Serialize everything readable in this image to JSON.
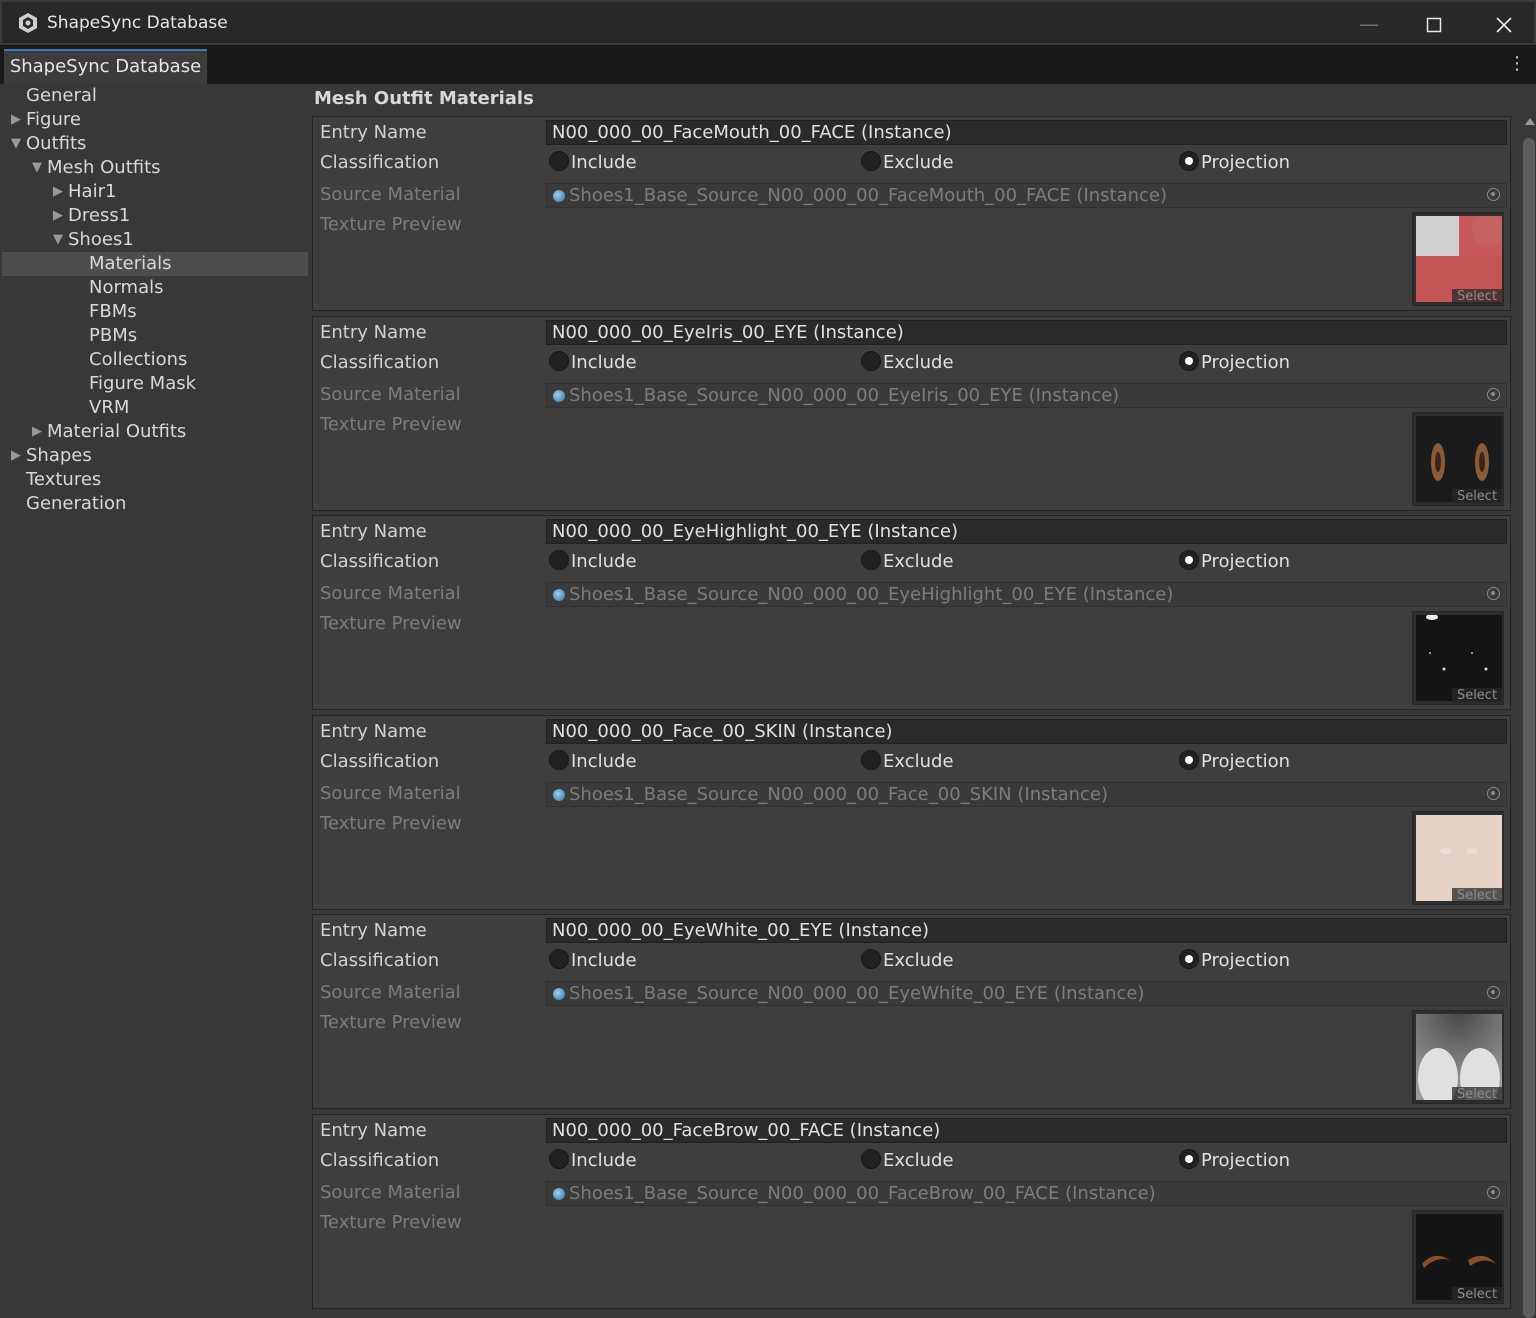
{
  "window": {
    "title": "ShapeSync Database",
    "controls": [
      "minimize-icon",
      "maximize-icon",
      "close-icon"
    ]
  },
  "tab": {
    "label": "ShapeSync Database",
    "menu_icon": "more-vertical-icon"
  },
  "sidebar": {
    "items": [
      {
        "label": "General"
      },
      {
        "label": "Figure",
        "arrow": "▶"
      },
      {
        "label": "Outfits",
        "arrow": "▼"
      },
      {
        "label": "Mesh Outfits",
        "arrow": "▼"
      },
      {
        "label": "Hair1",
        "arrow": "▶"
      },
      {
        "label": "Dress1",
        "arrow": "▶"
      },
      {
        "label": "Shoes1",
        "arrow": "▼"
      },
      {
        "label": "Materials",
        "selected": true
      },
      {
        "label": "Normals"
      },
      {
        "label": "FBMs"
      },
      {
        "label": "PBMs"
      },
      {
        "label": "Collections"
      },
      {
        "label": "Figure Mask"
      },
      {
        "label": "VRM"
      },
      {
        "label": "Material Outfits",
        "arrow": "▶"
      },
      {
        "label": "Shapes",
        "arrow": "▶"
      },
      {
        "label": "Textures"
      },
      {
        "label": "Generation"
      }
    ]
  },
  "main": {
    "section_title": "Mesh Outfit Materials",
    "labels": {
      "entry_name": "Entry Name",
      "classification": "Classification",
      "source_material": "Source Material",
      "texture_preview": "Texture Preview"
    },
    "options": {
      "include": "Include",
      "exclude": "Exclude",
      "projection": "Projection"
    },
    "select_label": "Select",
    "entries": [
      {
        "entry_name": "N00_000_00_FaceMouth_00_FACE (Instance)",
        "classification": "Projection",
        "source_material": "Shoes1_Base_Source_N00_000_00_FaceMouth_00_FACE (Instance)",
        "texture": "face-mouth-texture"
      },
      {
        "entry_name": "N00_000_00_EyeIris_00_EYE (Instance)",
        "classification": "Projection",
        "source_material": "Shoes1_Base_Source_N00_000_00_EyeIris_00_EYE (Instance)",
        "texture": "eye-iris-texture"
      },
      {
        "entry_name": "N00_000_00_EyeHighlight_00_EYE (Instance)",
        "classification": "Projection",
        "source_material": "Shoes1_Base_Source_N00_000_00_EyeHighlight_00_EYE (Instance)",
        "texture": "eye-highlight-texture"
      },
      {
        "entry_name": "N00_000_00_Face_00_SKIN (Instance)",
        "classification": "Projection",
        "source_material": "Shoes1_Base_Source_N00_000_00_Face_00_SKIN (Instance)",
        "texture": "face-skin-texture"
      },
      {
        "entry_name": "N00_000_00_EyeWhite_00_EYE (Instance)",
        "classification": "Projection",
        "source_material": "Shoes1_Base_Source_N00_000_00_EyeWhite_00_EYE (Instance)",
        "texture": "eye-white-texture"
      },
      {
        "entry_name": "N00_000_00_FaceBrow_00_FACE (Instance)",
        "classification": "Projection",
        "source_material": "Shoes1_Base_Source_N00_000_00_FaceBrow_00_FACE (Instance)",
        "texture": "face-brow-texture"
      }
    ]
  }
}
